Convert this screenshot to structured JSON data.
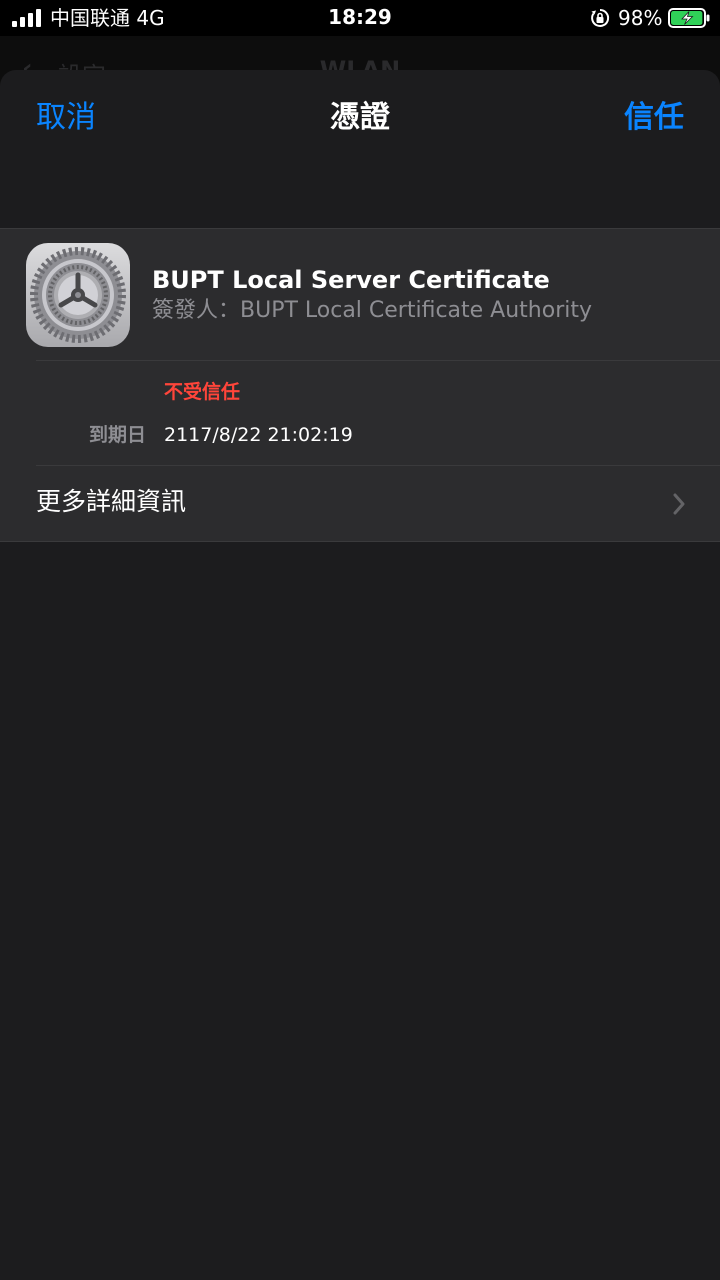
{
  "status_bar": {
    "carrier": "中国联通  4G",
    "time": "18:29",
    "battery_percent": "98%",
    "battery_level": 0.98,
    "charging": true,
    "icons": [
      "signal-icon",
      "orientation-lock-icon",
      "battery-charging-icon"
    ]
  },
  "underlying": {
    "back_label": "設定",
    "title": "WLAN"
  },
  "nav": {
    "cancel": "取消",
    "title": "憑證",
    "trust": "信任"
  },
  "certificate": {
    "name": "BUPT Local Server Certificate",
    "issuer": "簽發人：BUPT Local Certificate Authority",
    "status": "不受信任",
    "expiry_label": "到期日",
    "expiry_value": "2117/8/22 21:02:19",
    "icon": "settings-gear-icon"
  },
  "more_details": {
    "label": "更多詳細資訊",
    "icon": "chevron-right-icon"
  },
  "colors": {
    "accent": "#0a84ff",
    "danger": "#ff453a",
    "background": "#1c1c1e",
    "cell": "#2c2c2e",
    "secondary_text": "#8e8e93"
  }
}
